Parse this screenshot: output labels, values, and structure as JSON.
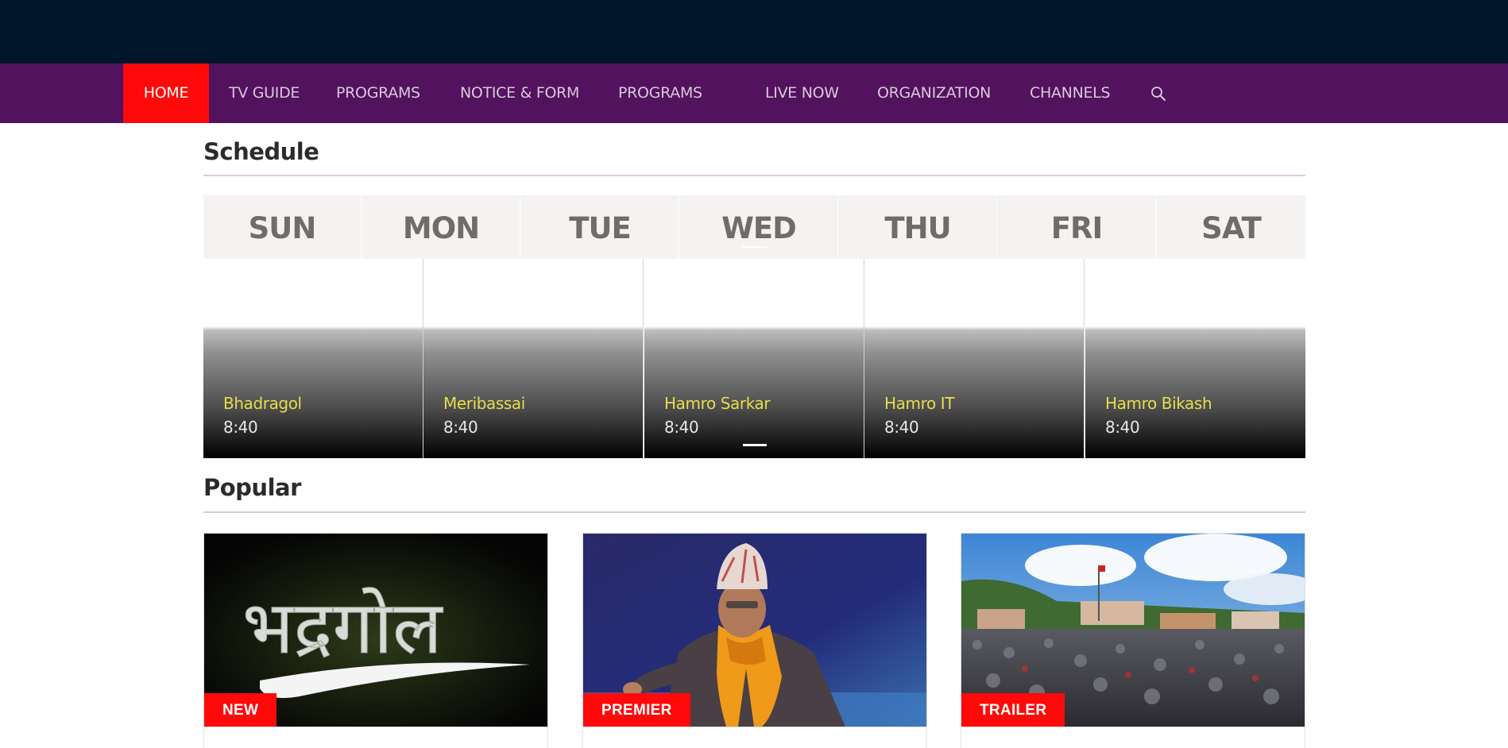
{
  "nav": {
    "items": [
      {
        "label": "HOME",
        "active": true
      },
      {
        "label": "TV GUIDE"
      },
      {
        "label": "PROGRAMS"
      },
      {
        "label": "NOTICE & FORM"
      },
      {
        "label": "PROGRAMS"
      },
      {
        "label": "LIVE NOW"
      },
      {
        "label": "ORGANIZATION"
      },
      {
        "label": "CHANNELS"
      }
    ],
    "search_icon": "search-icon"
  },
  "schedule": {
    "title": "Schedule",
    "days": [
      "SUN",
      "MON",
      "TUE",
      "WED",
      "THU",
      "FRI",
      "SAT"
    ],
    "shows": [
      {
        "title": "Bhadragol",
        "time": "8:40"
      },
      {
        "title": "Meribassai",
        "time": "8:40"
      },
      {
        "title": "Hamro Sarkar",
        "time": "8:40"
      },
      {
        "title": "Hamro IT",
        "time": "8:40"
      },
      {
        "title": "Hamro Bikash",
        "time": "8:40"
      }
    ]
  },
  "popular": {
    "title": "Popular",
    "cards": [
      {
        "badge": "NEW",
        "logo_text": "भद्रगोल"
      },
      {
        "badge": "PREMIER"
      },
      {
        "badge": "TRAILER"
      }
    ]
  },
  "colors": {
    "topbar": "#01152a",
    "nav_bg": "#53125e",
    "accent_red": "#ff0a0a",
    "show_title": "#e6dd4b"
  }
}
